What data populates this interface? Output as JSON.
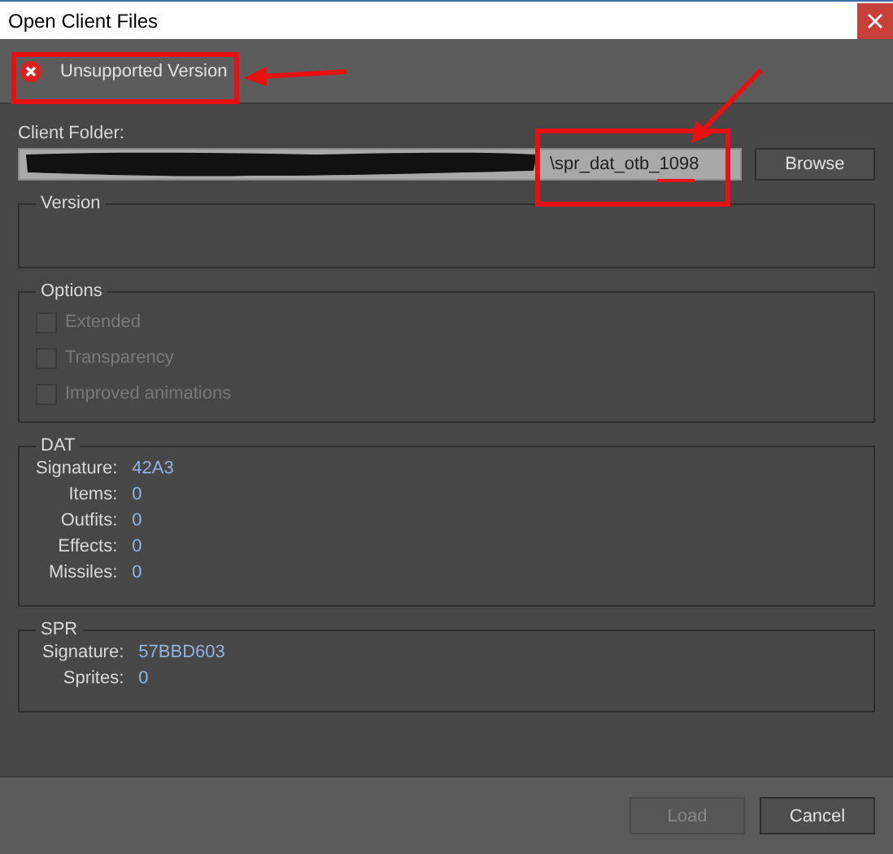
{
  "window": {
    "title": "Open Client Files"
  },
  "status": {
    "kind": "error",
    "text": "Unsupported Version"
  },
  "client_folder": {
    "label": "Client Folder:",
    "value": "\\spr_dat_otb_1098",
    "browse": "Browse"
  },
  "version": {
    "title": "Version"
  },
  "options": {
    "title": "Options",
    "items": [
      {
        "label": "Extended",
        "checked": false,
        "disabled": true
      },
      {
        "label": "Transparency",
        "checked": false,
        "disabled": true
      },
      {
        "label": "Improved animations",
        "checked": false,
        "disabled": true
      }
    ]
  },
  "dat": {
    "title": "DAT",
    "fields": [
      {
        "label": "Signature:",
        "value": "42A3"
      },
      {
        "label": "Items:",
        "value": "0"
      },
      {
        "label": "Outfits:",
        "value": "0"
      },
      {
        "label": "Effects:",
        "value": "0"
      },
      {
        "label": "Missiles:",
        "value": "0"
      }
    ]
  },
  "spr": {
    "title": "SPR",
    "fields": [
      {
        "label": "Signature:",
        "value": "57BBD603"
      },
      {
        "label": "Sprites:",
        "value": "0"
      }
    ]
  },
  "buttons": [
    {
      "label": "Load",
      "disabled": true
    },
    {
      "label": "Cancel",
      "disabled": false
    }
  ]
}
